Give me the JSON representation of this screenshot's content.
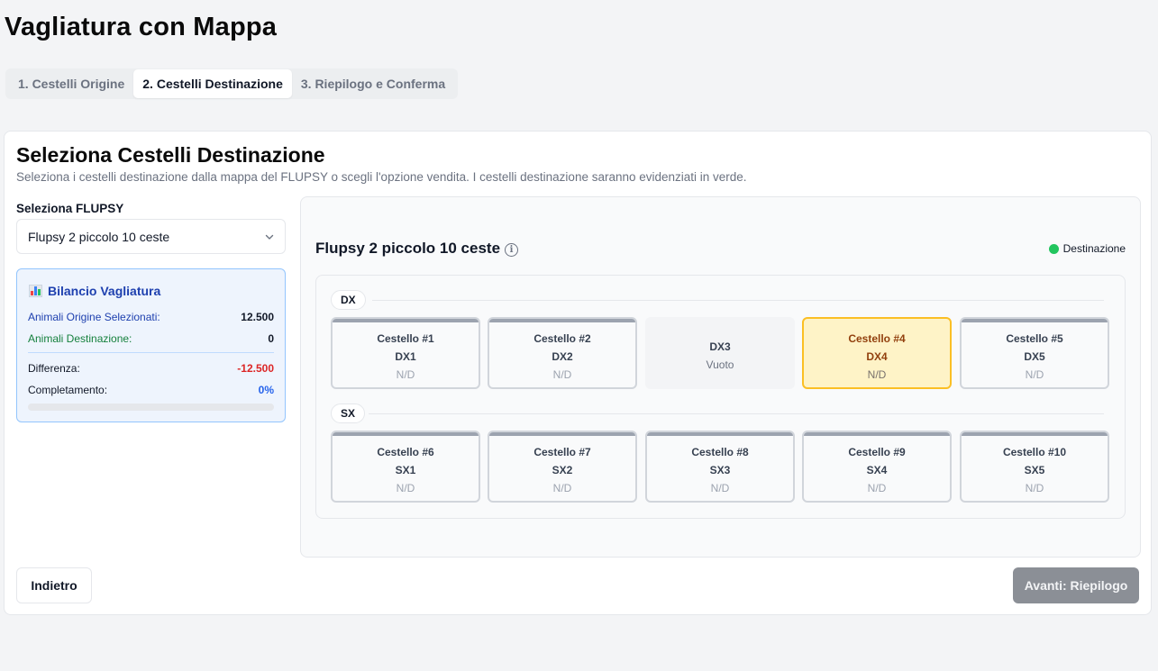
{
  "page_title": "Vagliatura con Mappa",
  "tabs": [
    {
      "label": "1. Cestelli Origine",
      "active": false
    },
    {
      "label": "2. Cestelli Destinazione",
      "active": true
    },
    {
      "label": "3. Riepilogo e Conferma",
      "active": false
    }
  ],
  "card": {
    "title": "Seleziona Cestelli Destinazione",
    "description": "Seleziona i cestelli destinazione dalla mappa del FLUPSY o scegli l'opzione vendita. I cestelli destinazione saranno evidenziati in verde."
  },
  "flupsy_select": {
    "label": "Seleziona FLUPSY",
    "value": "Flupsy 2 piccolo 10 ceste"
  },
  "balance": {
    "title": "Bilancio Vagliatura",
    "origin_label": "Animali Origine Selezionati:",
    "origin_value": "12.500",
    "dest_label": "Animali Destinazione:",
    "dest_value": "0",
    "diff_label": "Differenza:",
    "diff_value": "-12.500",
    "completion_label": "Completamento:",
    "completion_value": "0%",
    "completion_fraction": 0,
    "colors": {
      "origin": "#1e40af",
      "dest": "#15803d",
      "diff": "#dc2626",
      "completion": "#2563eb"
    }
  },
  "map": {
    "title": "Flupsy 2 piccolo 10 ceste",
    "legend_label": "Destinazione",
    "legend_color": "#22c55e",
    "rows": [
      {
        "label": "DX",
        "baskets": [
          {
            "name": "Cestello #1",
            "position": "DX1",
            "value": "N/D",
            "state": "normal"
          },
          {
            "name": "Cestello #2",
            "position": "DX2",
            "value": "N/D",
            "state": "normal"
          },
          {
            "name": "",
            "position": "DX3",
            "value": "Vuoto",
            "state": "empty"
          },
          {
            "name": "Cestello #4",
            "position": "DX4",
            "value": "N/D",
            "state": "selected"
          },
          {
            "name": "Cestello #5",
            "position": "DX5",
            "value": "N/D",
            "state": "normal"
          }
        ]
      },
      {
        "label": "SX",
        "baskets": [
          {
            "name": "Cestello #6",
            "position": "SX1",
            "value": "N/D",
            "state": "normal"
          },
          {
            "name": "Cestello #7",
            "position": "SX2",
            "value": "N/D",
            "state": "normal"
          },
          {
            "name": "Cestello #8",
            "position": "SX3",
            "value": "N/D",
            "state": "normal"
          },
          {
            "name": "Cestello #9",
            "position": "SX4",
            "value": "N/D",
            "state": "normal"
          },
          {
            "name": "Cestello #10",
            "position": "SX5",
            "value": "N/D",
            "state": "normal"
          }
        ]
      }
    ]
  },
  "buttons": {
    "back": "Indietro",
    "next": "Avanti: Riepilogo"
  }
}
